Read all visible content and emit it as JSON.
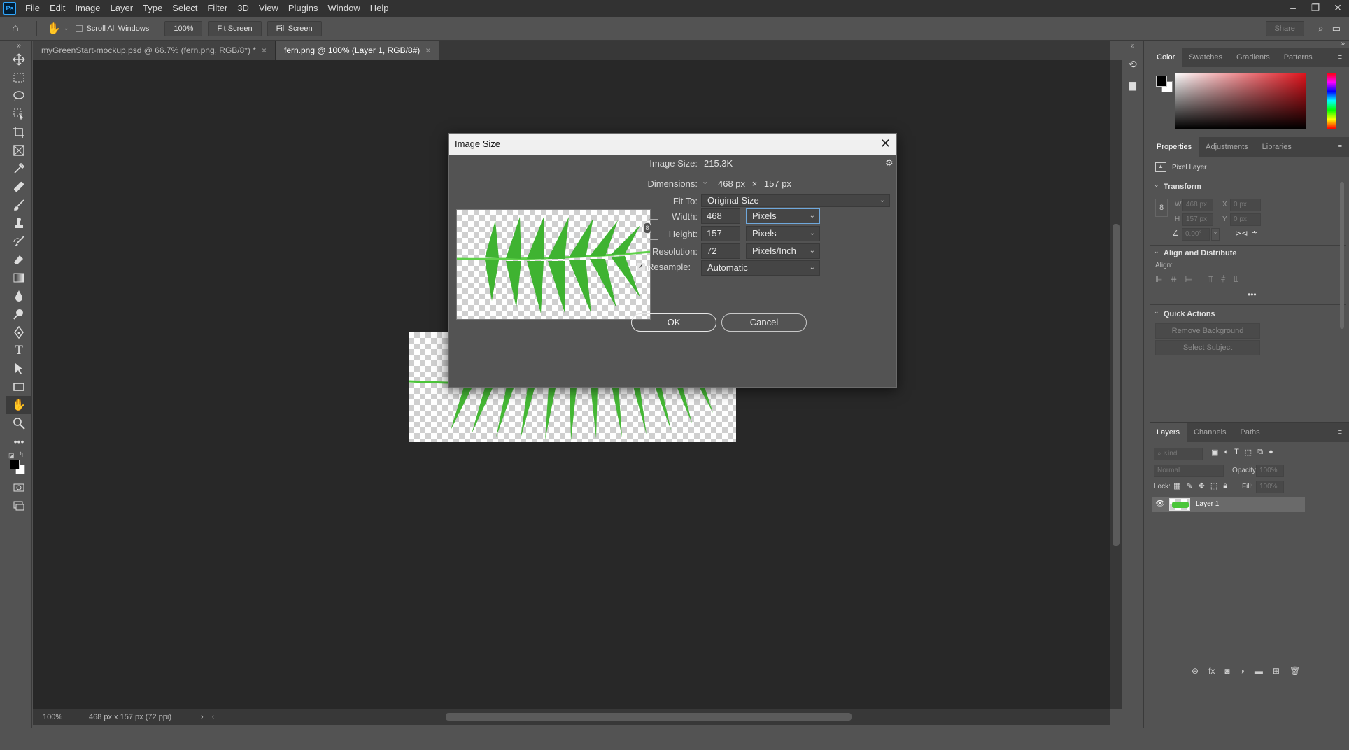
{
  "app": {
    "logo": "Ps"
  },
  "menu": [
    "File",
    "Edit",
    "Image",
    "Layer",
    "Type",
    "Select",
    "Filter",
    "3D",
    "View",
    "Plugins",
    "Window",
    "Help"
  ],
  "options": {
    "scroll_all": "Scroll All Windows",
    "zoom": "100%",
    "fit_screen": "Fit Screen",
    "fill_screen": "Fill Screen",
    "share": "Share"
  },
  "tabs": [
    {
      "label": "myGreenStart-mockup.psd @ 66.7% (fern.png, RGB/8*) *"
    },
    {
      "label": "fern.png @ 100% (Layer 1, RGB/8#)"
    }
  ],
  "status": {
    "zoom": "100%",
    "info": "468 px x 157 px (72 ppi)"
  },
  "dialog": {
    "title": "Image Size",
    "image_size_label": "Image Size:",
    "image_size_value": "215.3K",
    "dimensions_label": "Dimensions:",
    "dim_w": "468 px",
    "dim_x": "×",
    "dim_h": "157 px",
    "fit_to_label": "Fit To:",
    "fit_to_value": "Original Size",
    "width_label": "Width:",
    "width_value": "468",
    "width_unit": "Pixels",
    "height_label": "Height:",
    "height_value": "157",
    "height_unit": "Pixels",
    "resolution_label": "Resolution:",
    "resolution_value": "72",
    "resolution_unit": "Pixels/Inch",
    "resample_label": "Resample:",
    "resample_value": "Automatic",
    "ok": "OK",
    "cancel": "Cancel"
  },
  "color_panel": {
    "tabs": [
      "Color",
      "Swatches",
      "Gradients",
      "Patterns"
    ]
  },
  "properties_panel": {
    "tabs": [
      "Properties",
      "Adjustments",
      "Libraries"
    ],
    "layer_type": "Pixel Layer",
    "transform": "Transform",
    "w": "W",
    "w_val": "468 px",
    "x": "X",
    "x_val": "0 px",
    "h": "H",
    "h_val": "157 px",
    "y": "Y",
    "y_val": "0 px",
    "angle_val": "0.00°",
    "align_distribute": "Align and Distribute",
    "align": "Align:",
    "quick_actions": "Quick Actions",
    "remove_bg": "Remove Background",
    "select_subject": "Select Subject"
  },
  "layers_panel": {
    "tabs": [
      "Layers",
      "Channels",
      "Paths"
    ],
    "kind": "Kind",
    "blend": "Normal",
    "opacity_label": "Opacity:",
    "opacity_val": "100%",
    "lock_label": "Lock:",
    "fill_label": "Fill:",
    "fill_val": "100%",
    "layer_name": "Layer 1"
  },
  "colors": {
    "accent": "#31a8ff",
    "fern": "#4cc63a"
  }
}
